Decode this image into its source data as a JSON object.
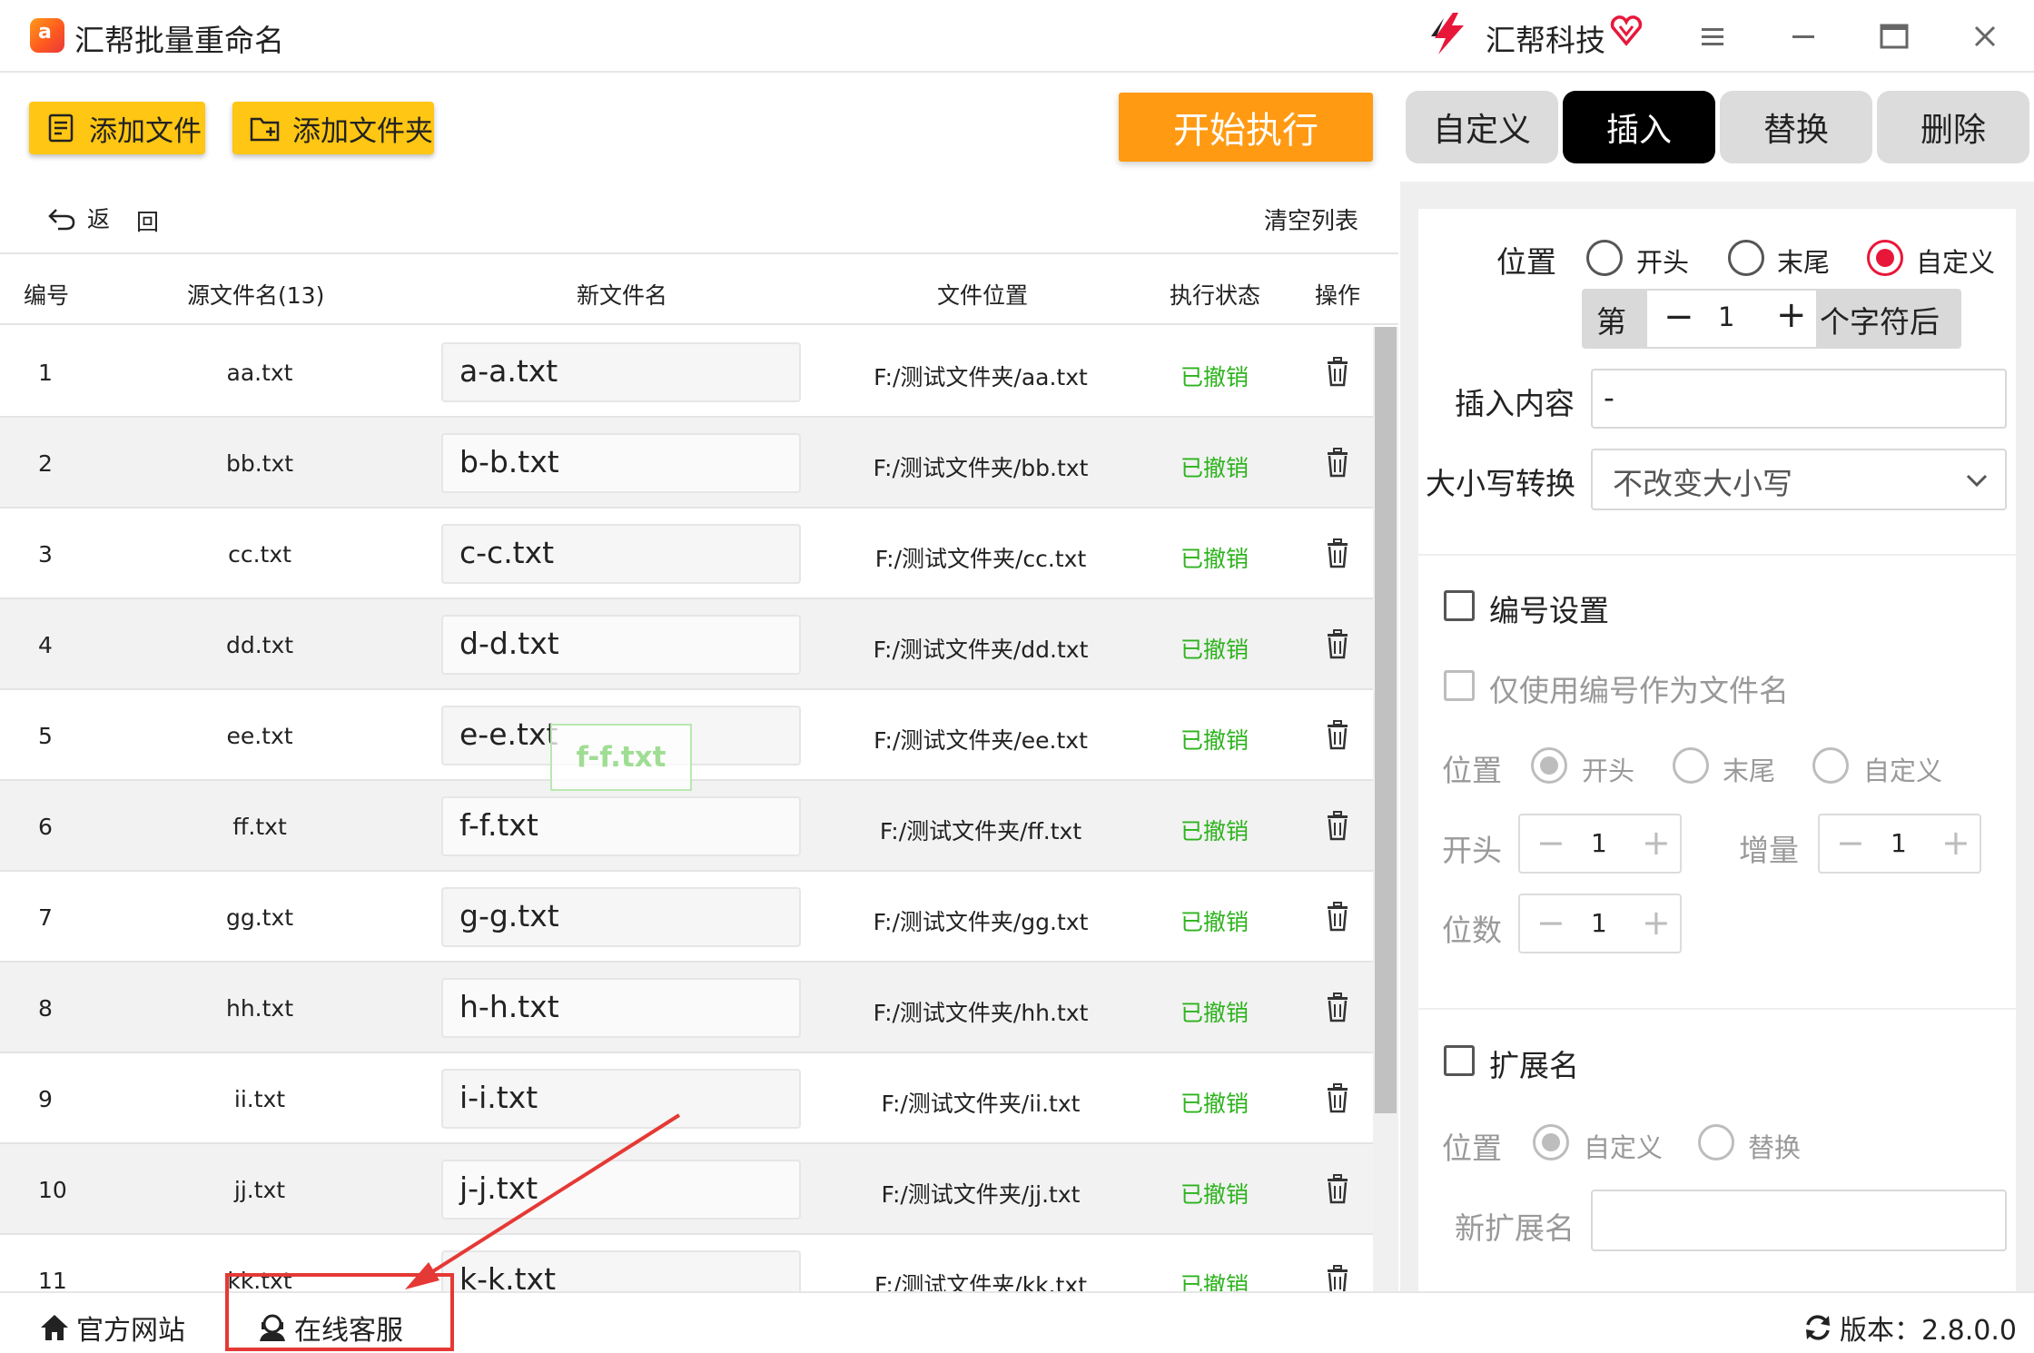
{
  "titlebar": {
    "app_title": "汇帮批量重命名",
    "brand_name": "汇帮科技",
    "icons": [
      "app-logo-icon",
      "brand-logo-icon",
      "vip-heart-icon",
      "menu-icon",
      "minimize-icon",
      "maximize-icon",
      "close-icon"
    ]
  },
  "toolbar": {
    "add_file_label": "添加文件",
    "add_folder_label": "添加文件夹",
    "start_label": "开始执行",
    "accent_color": "#ff9a12",
    "button_color": "#ffc613"
  },
  "tabs": [
    {
      "label": "自定义",
      "active": false
    },
    {
      "label": "插入",
      "active": true
    },
    {
      "label": "替换",
      "active": false
    },
    {
      "label": "删除",
      "active": false
    }
  ],
  "list": {
    "back_label": "返",
    "undo_label": "回",
    "clear_label": "清空列表",
    "headers": {
      "no": "编号",
      "source": "源文件名(13)",
      "new_name": "新文件名",
      "path": "文件位置",
      "status": "执行状态",
      "op": "操作"
    },
    "status_color": "#2db31d",
    "rows": [
      {
        "no": "1",
        "source": "aa.txt",
        "new_name": "a-a.txt",
        "path": "F:/测试文件夹/aa.txt",
        "status": "已撤销"
      },
      {
        "no": "2",
        "source": "bb.txt",
        "new_name": "b-b.txt",
        "path": "F:/测试文件夹/bb.txt",
        "status": "已撤销"
      },
      {
        "no": "3",
        "source": "cc.txt",
        "new_name": "c-c.txt",
        "path": "F:/测试文件夹/cc.txt",
        "status": "已撤销"
      },
      {
        "no": "4",
        "source": "dd.txt",
        "new_name": "d-d.txt",
        "path": "F:/测试文件夹/dd.txt",
        "status": "已撤销"
      },
      {
        "no": "5",
        "source": "ee.txt",
        "new_name": "e-e.txt",
        "path": "F:/测试文件夹/ee.txt",
        "status": "已撤销"
      },
      {
        "no": "6",
        "source": "ff.txt",
        "new_name": "f-f.txt",
        "path": "F:/测试文件夹/ff.txt",
        "status": "已撤销"
      },
      {
        "no": "7",
        "source": "gg.txt",
        "new_name": "g-g.txt",
        "path": "F:/测试文件夹/gg.txt",
        "status": "已撤销"
      },
      {
        "no": "8",
        "source": "hh.txt",
        "new_name": "h-h.txt",
        "path": "F:/测试文件夹/hh.txt",
        "status": "已撤销"
      },
      {
        "no": "9",
        "source": "ii.txt",
        "new_name": "i-i.txt",
        "path": "F:/测试文件夹/ii.txt",
        "status": "已撤销"
      },
      {
        "no": "10",
        "source": "jj.txt",
        "new_name": "j-j.txt",
        "path": "F:/测试文件夹/jj.txt",
        "status": "已撤销"
      },
      {
        "no": "11",
        "source": "kk.txt",
        "new_name": "k-k.txt",
        "path": "F:/测试文件夹/kk.txt",
        "status": "已撤销"
      }
    ],
    "drag_ghost_text": "f-f.txt"
  },
  "insert_panel": {
    "position_label": "位置",
    "position_options": [
      {
        "label": "开头",
        "checked": false
      },
      {
        "label": "末尾",
        "checked": false
      },
      {
        "label": "自定义",
        "checked": true
      }
    ],
    "nth_prefix": "第",
    "nth_minus": "−",
    "nth_value": "1",
    "nth_plus": "+",
    "nth_suffix": "个字符后",
    "content_label": "插入内容",
    "content_value": "-",
    "case_label": "大小写转换",
    "case_value": "不改变大小写",
    "radio_color": "#e8173a"
  },
  "numbering": {
    "enable_label": "编号设置",
    "only_number_label": "仅使用编号作为文件名",
    "position_label": "位置",
    "position_options": [
      {
        "label": "开头",
        "checked": true
      },
      {
        "label": "末尾",
        "checked": false
      },
      {
        "label": "自定义",
        "checked": false
      }
    ],
    "start_label": "开头",
    "start_value": "1",
    "step_label": "增量",
    "step_value": "1",
    "digits_label": "位数",
    "digits_value": "1",
    "minus": "−",
    "plus": "+"
  },
  "extension": {
    "enable_label": "扩展名",
    "position_label": "位置",
    "position_options": [
      {
        "label": "自定义",
        "checked": true
      },
      {
        "label": "替换",
        "checked": false
      }
    ],
    "new_ext_label": "新扩展名",
    "new_ext_value": ""
  },
  "footer": {
    "official_site": "官方网站",
    "online_service": "在线客服",
    "version": "版本：2.8.0.0",
    "highlight_color": "#e53935"
  }
}
